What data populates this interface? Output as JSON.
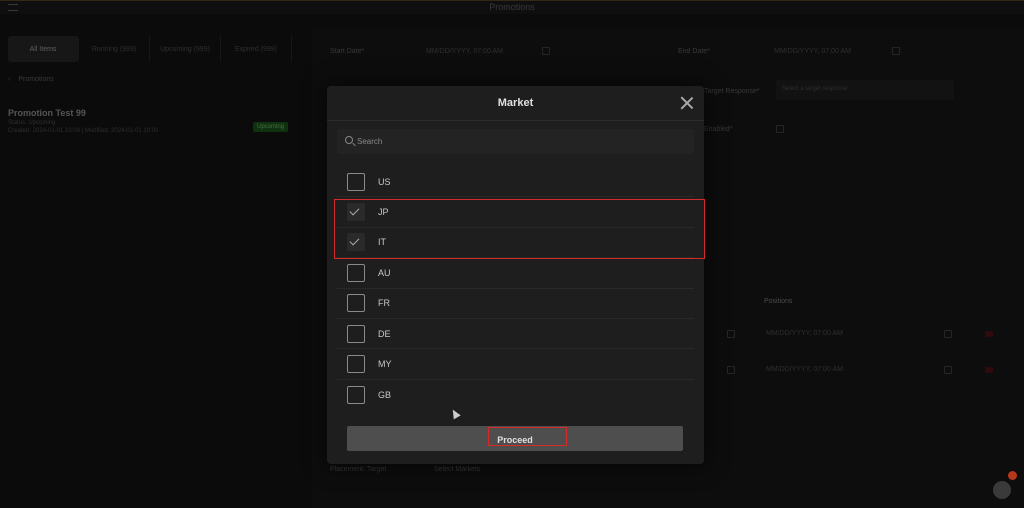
{
  "app": {
    "title": "Promotions",
    "left_panel": {
      "tabs": [
        "All Items",
        "Running (999)",
        "Upcoming (999)",
        "Expired (999)"
      ],
      "back_label": "Promotions",
      "card": {
        "name": "Promotion Test 99",
        "line1": "Status: Upcoming",
        "line2": "Created: 2024-01-01 10:00 | Modified: 2024-01-01 10:00",
        "badge": "Upcoming"
      }
    },
    "main_panel": {
      "start_date_label": "Start Date*",
      "start_date_value": "MM/DD/YYYY, 07:00 AM",
      "end_date_label": "End Date*",
      "end_date_value": "MM/DD/YYYY, 07:00 AM",
      "target_label": "Target Response*",
      "target_value": "Select a target response",
      "enabled_label": "Enabled*",
      "positions_label": "Positions",
      "row1_value": "MM/DD/YYYY, 07:00 AM",
      "row2_value": "MM/DD/YYYY, 07:00 AM",
      "bottom_left": "Placement: Target",
      "bottom_right": "Select Markets"
    }
  },
  "modal": {
    "title": "Market",
    "search": {
      "placeholder": "Search"
    },
    "markets": [
      {
        "code": "US",
        "checked": false
      },
      {
        "code": "JP",
        "checked": true
      },
      {
        "code": "IT",
        "checked": true
      },
      {
        "code": "AU",
        "checked": false
      },
      {
        "code": "FR",
        "checked": false
      },
      {
        "code": "DE",
        "checked": false
      },
      {
        "code": "MY",
        "checked": false
      },
      {
        "code": "GB",
        "checked": false
      }
    ],
    "proceed_label": "Proceed"
  },
  "colors": {
    "highlight": "#d42a2a",
    "modal_bg": "#1e1e1e",
    "button_bg": "#4e4e4e",
    "badge_green": "#1e5a1e"
  },
  "icons": [
    "menu-icon",
    "back-arrow-icon",
    "close-icon",
    "search-icon",
    "check-icon",
    "calendar-icon",
    "help-icon"
  ]
}
